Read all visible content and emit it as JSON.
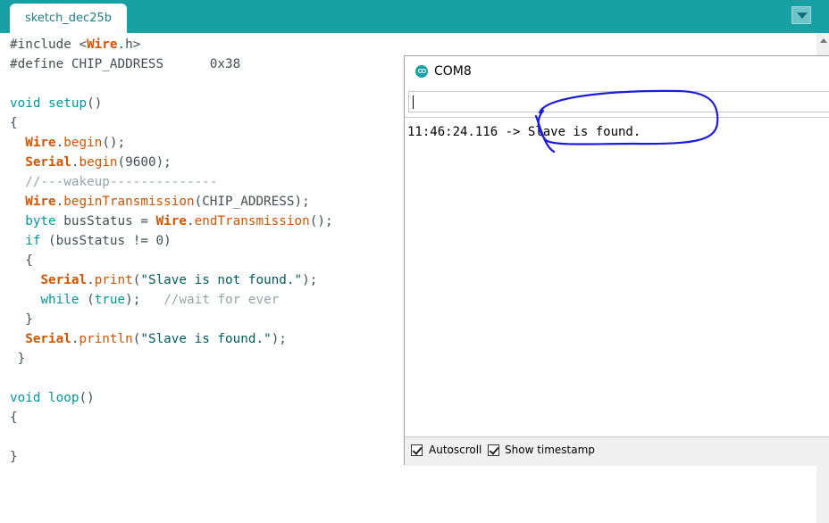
{
  "tab": {
    "label": "sketch_dec25b"
  },
  "code_lines": [
    [
      {
        "t": "#include <",
        "c": "pp"
      },
      {
        "t": "Wire",
        "c": "fn"
      },
      {
        "t": ".h>",
        "c": "pp"
      }
    ],
    [
      {
        "t": "#define CHIP_ADDRESS      0x38",
        "c": "pp"
      }
    ],
    [],
    [
      {
        "t": "void",
        "c": "kw"
      },
      {
        "t": " "
      },
      {
        "t": "setup",
        "c": "kw"
      },
      {
        "t": "()"
      }
    ],
    [
      {
        "t": "{"
      }
    ],
    [
      {
        "t": "  "
      },
      {
        "t": "Wire",
        "c": "fn"
      },
      {
        "t": "."
      },
      {
        "t": "begin",
        "c": "mt"
      },
      {
        "t": "();"
      }
    ],
    [
      {
        "t": "  "
      },
      {
        "t": "Serial",
        "c": "fn"
      },
      {
        "t": "."
      },
      {
        "t": "begin",
        "c": "mt"
      },
      {
        "t": "(9600);"
      }
    ],
    [
      {
        "t": "  //---wakeup--------------",
        "c": "cm"
      }
    ],
    [
      {
        "t": "  "
      },
      {
        "t": "Wire",
        "c": "fn"
      },
      {
        "t": "."
      },
      {
        "t": "beginTransmission",
        "c": "mt"
      },
      {
        "t": "(CHIP_ADDRESS);"
      }
    ],
    [
      {
        "t": "  "
      },
      {
        "t": "byte",
        "c": "kw"
      },
      {
        "t": " busStatus = "
      },
      {
        "t": "Wire",
        "c": "fn"
      },
      {
        "t": "."
      },
      {
        "t": "endTransmission",
        "c": "mt"
      },
      {
        "t": "();"
      }
    ],
    [
      {
        "t": "  "
      },
      {
        "t": "if",
        "c": "kw"
      },
      {
        "t": " (busStatus != 0)"
      }
    ],
    [
      {
        "t": "  {"
      }
    ],
    [
      {
        "t": "    "
      },
      {
        "t": "Serial",
        "c": "fn"
      },
      {
        "t": "."
      },
      {
        "t": "print",
        "c": "mt"
      },
      {
        "t": "("
      },
      {
        "t": "\"Slave is not found.\"",
        "c": "str"
      },
      {
        "t": ");"
      }
    ],
    [
      {
        "t": "    "
      },
      {
        "t": "while",
        "c": "kw"
      },
      {
        "t": " ("
      },
      {
        "t": "true",
        "c": "kw"
      },
      {
        "t": ");   "
      },
      {
        "t": "//wait for ever",
        "c": "cm"
      }
    ],
    [
      {
        "t": "  }"
      }
    ],
    [
      {
        "t": "  "
      },
      {
        "t": "Serial",
        "c": "fn"
      },
      {
        "t": "."
      },
      {
        "t": "println",
        "c": "mt"
      },
      {
        "t": "("
      },
      {
        "t": "\"Slave is found.\"",
        "c": "str"
      },
      {
        "t": ");"
      }
    ],
    [
      {
        "t": " }"
      }
    ],
    [],
    [
      {
        "t": "void",
        "c": "kw"
      },
      {
        "t": " "
      },
      {
        "t": "loop",
        "c": "kw"
      },
      {
        "t": "()"
      }
    ],
    [
      {
        "t": "{"
      }
    ],
    [],
    [
      {
        "t": "}"
      }
    ]
  ],
  "serial_monitor": {
    "title": "COM8",
    "input_value": "",
    "output_line": "11:46:24.116 -> Slave is found.",
    "autoscroll_label": "Autoscroll",
    "timestamp_label": "Show timestamp",
    "annotation_color": "#1a1ae0"
  },
  "colors": {
    "accent": "#17a1a5"
  }
}
